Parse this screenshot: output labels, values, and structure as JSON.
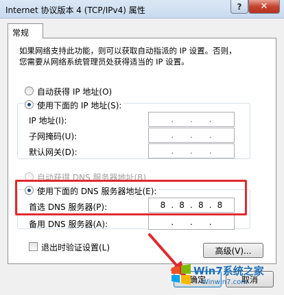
{
  "window": {
    "title": "Internet 协议版本 4 (TCP/IPv4) 属性",
    "help_glyph": "?",
    "close_glyph": "✕"
  },
  "tab": {
    "label": "常规"
  },
  "description": {
    "line1": "如果网络支持此功能，则可以获取自动指派的 IP 设置。否则，",
    "line2": "您需要从网络系统管理员处获得适当的 IP 设置。"
  },
  "ip": {
    "auto_label": "自动获得 IP 地址(O)",
    "manual_label": "使用下面的 IP 地址(S):",
    "address_label": "IP 地址(I):",
    "subnet_label": "子网掩码(U):",
    "gateway_label": "默认网关(D):",
    "address": [
      "",
      "",
      "",
      ""
    ],
    "subnet": [
      "",
      "",
      "",
      ""
    ],
    "gateway": [
      "",
      "",
      "",
      ""
    ],
    "selected": "manual"
  },
  "dns": {
    "auto_label": "自动获得 DNS 服务器地址(B)",
    "manual_label": "使用下面的 DNS 服务器地址(E):",
    "preferred_label": "首选 DNS 服务器(P):",
    "alternate_label": "备用 DNS 服务器(A):",
    "preferred": [
      "8",
      "8",
      "8",
      "8"
    ],
    "alternate": [
      "",
      "",
      "",
      ""
    ],
    "selected": "manual"
  },
  "validate": {
    "label": "退出时验证设置(L)",
    "checked": false
  },
  "buttons": {
    "advanced": "高级(V)...",
    "ok": "确定",
    "cancel": "取消"
  },
  "watermark": {
    "brand": "Win7系统之家",
    "url": "Winwin7.com"
  },
  "colors": {
    "highlight": "#e0292f",
    "titlebar": "#c9dbef"
  }
}
